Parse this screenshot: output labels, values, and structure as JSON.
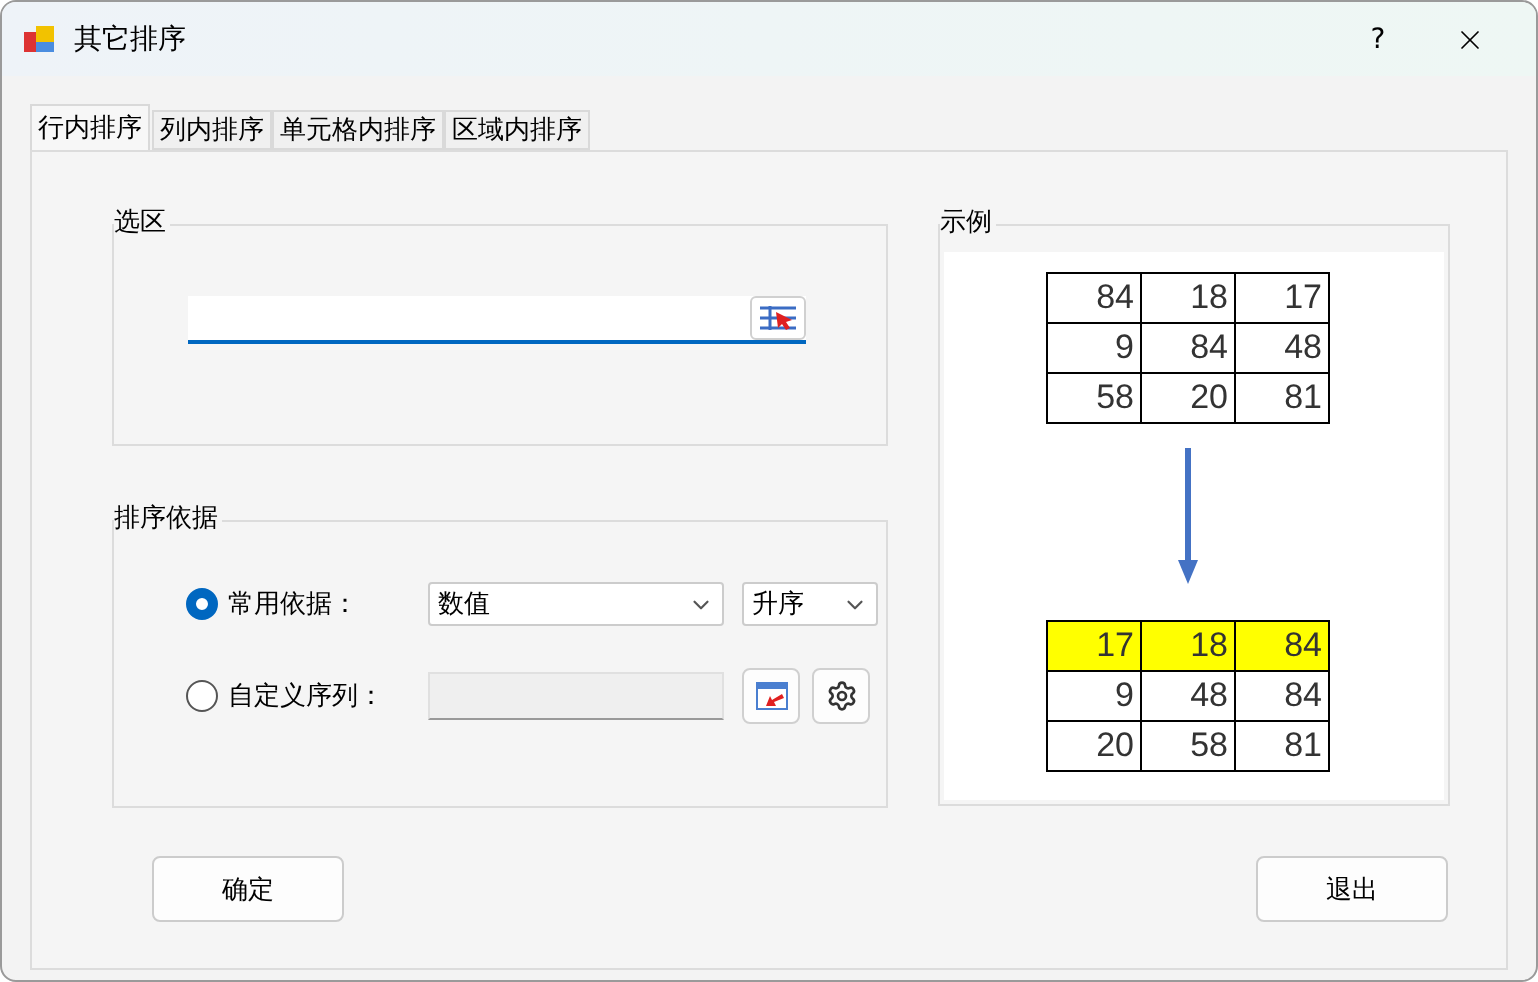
{
  "window": {
    "title": "其它排序",
    "help": "?"
  },
  "tabs": [
    {
      "label": "行内排序",
      "selected": true
    },
    {
      "label": "列内排序",
      "selected": false
    },
    {
      "label": "单元格内排序",
      "selected": false
    },
    {
      "label": "区域内排序",
      "selected": false
    }
  ],
  "selection": {
    "title": "选区"
  },
  "sort_basis": {
    "title": "排序依据",
    "options": [
      {
        "kind": "dropdowns",
        "label": "常用依据：",
        "selected": true,
        "dropdowns": [
          "数值",
          "升序"
        ]
      },
      {
        "kind": "custom",
        "label": "自定义序列：",
        "selected": false
      }
    ]
  },
  "example": {
    "title": "示例",
    "before": [
      {
        "highlighted": false,
        "cells": [
          "84",
          "18",
          "17"
        ]
      },
      {
        "highlighted": false,
        "cells": [
          "9",
          "84",
          "48"
        ]
      },
      {
        "highlighted": false,
        "cells": [
          "58",
          "20",
          "81"
        ]
      }
    ],
    "after": [
      {
        "highlighted": true,
        "cells": [
          "17",
          "18",
          "84"
        ]
      },
      {
        "highlighted": false,
        "cells": [
          "9",
          "48",
          "84"
        ]
      },
      {
        "highlighted": false,
        "cells": [
          "20",
          "58",
          "81"
        ]
      }
    ]
  },
  "buttons": [
    "确定",
    "退出"
  ]
}
